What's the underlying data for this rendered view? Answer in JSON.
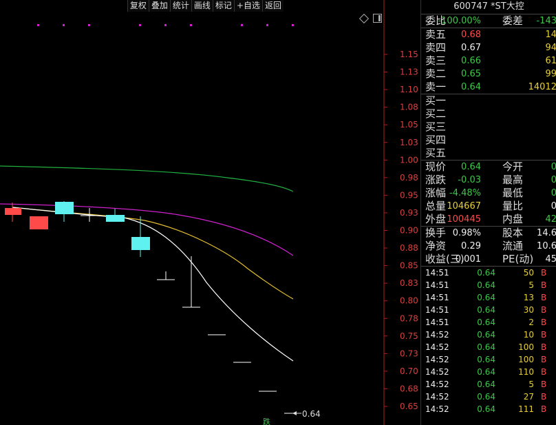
{
  "toolbar": [
    "复权",
    "叠加",
    "统计",
    "画线",
    "标记",
    "+自选",
    "返回"
  ],
  "chart": {
    "y_ticks": [
      "1.15",
      "1.13",
      "1.10",
      "1.08",
      "1.05",
      "1.03",
      "1.00",
      "0.98",
      "0.95",
      "0.93",
      "0.90",
      "0.88",
      "0.85",
      "0.83",
      "0.80",
      "0.78",
      "0.75",
      "0.73",
      "0.70",
      "0.68",
      "0.65"
    ],
    "last_price_label": "0.64",
    "limit_down_label": "跌",
    "colors": {
      "up": "#ff4a4a",
      "down": "#5ff0f0",
      "ma_white": "#ffffff",
      "ma_yellow": "#e8c030",
      "ma_magenta": "#d020d0",
      "ma_green": "#20b040"
    }
  },
  "panel": {
    "title": "600747 *ST大控",
    "wei": {
      "label1": "委比",
      "value1": "-100.00%",
      "label2": "委差",
      "value2": "-143"
    },
    "asks": [
      {
        "label": "卖五",
        "price": "0.68",
        "volume": "14"
      },
      {
        "label": "卖四",
        "price": "0.67",
        "volume": "94"
      },
      {
        "label": "卖三",
        "price": "0.66",
        "volume": "61"
      },
      {
        "label": "卖二",
        "price": "0.65",
        "volume": "99"
      },
      {
        "label": "卖一",
        "price": "0.64",
        "volume": "14012"
      }
    ],
    "bids": [
      {
        "label": "买一"
      },
      {
        "label": "买二"
      },
      {
        "label": "买三"
      },
      {
        "label": "买四"
      },
      {
        "label": "买五"
      }
    ],
    "quote": [
      {
        "l1": "现价",
        "v1": "0.64",
        "l2": "今开",
        "v2": "0"
      },
      {
        "l1": "涨跌",
        "v1": "-0.03",
        "l2": "最高",
        "v2": "0"
      },
      {
        "l1": "涨幅",
        "v1": "-4.48%",
        "l2": "最低",
        "v2": "0"
      },
      {
        "l1": "总量",
        "v1": "104667",
        "l2": "量比",
        "v2": "0"
      },
      {
        "l1": "外盘",
        "v1": "100445",
        "l2": "内盘",
        "v2": "42"
      }
    ],
    "stats": [
      {
        "l1": "换手",
        "v1": "0.98%",
        "l2": "股本",
        "v2": "14.6"
      },
      {
        "l1": "净资",
        "v1": "0.29",
        "l2": "流通",
        "v2": "10.6"
      },
      {
        "l1": "收益(三)",
        "v1": "0.001",
        "l2": "PE(动)",
        "v2": "45"
      }
    ],
    "ticks": [
      {
        "time": "14:51",
        "price": "0.64",
        "volume": "50",
        "dir": "B"
      },
      {
        "time": "14:51",
        "price": "0.64",
        "volume": "5",
        "dir": "B"
      },
      {
        "time": "14:51",
        "price": "0.64",
        "volume": "13",
        "dir": "B"
      },
      {
        "time": "14:51",
        "price": "0.64",
        "volume": "30",
        "dir": "B"
      },
      {
        "time": "14:51",
        "price": "0.64",
        "volume": "2",
        "dir": "B"
      },
      {
        "time": "14:52",
        "price": "0.64",
        "volume": "10",
        "dir": "B"
      },
      {
        "time": "14:52",
        "price": "0.64",
        "volume": "100",
        "dir": "B"
      },
      {
        "time": "14:52",
        "price": "0.64",
        "volume": "100",
        "dir": "B"
      },
      {
        "time": "14:52",
        "price": "0.64",
        "volume": "110",
        "dir": "B"
      },
      {
        "time": "14:52",
        "price": "0.64",
        "volume": "5",
        "dir": "B"
      },
      {
        "time": "14:52",
        "price": "0.64",
        "volume": "27",
        "dir": "B"
      },
      {
        "time": "14:52",
        "price": "0.64",
        "volume": "111",
        "dir": "B"
      }
    ]
  }
}
